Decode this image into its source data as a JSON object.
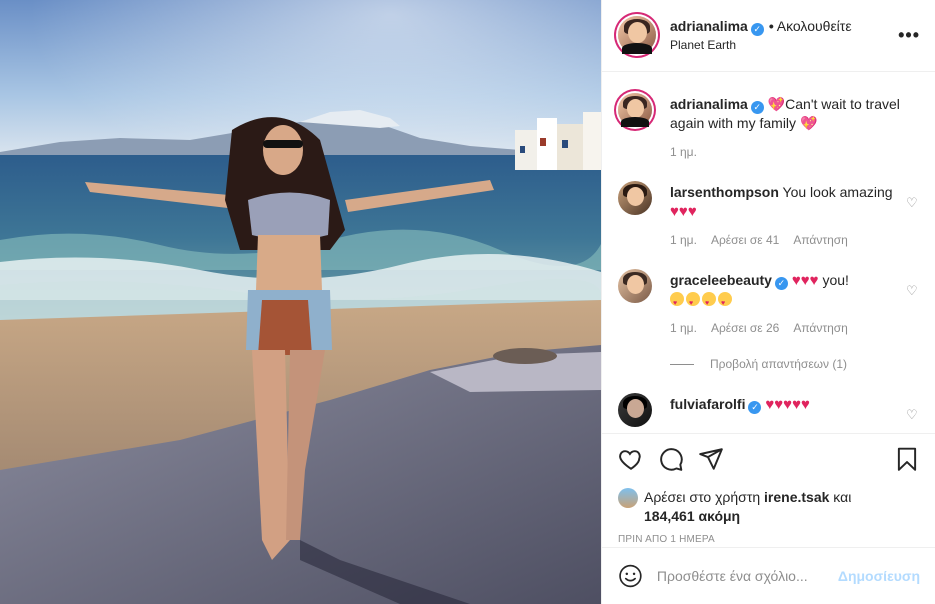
{
  "header": {
    "username": "adrianalima",
    "verified_mark": "✓",
    "separator": "•",
    "follow_status": "Ακολουθείτε",
    "location": "Planet Earth",
    "more_label": "•••"
  },
  "caption": {
    "username": "adrianalima",
    "text": "Can't wait to travel again with my family",
    "emoji_1": "💖",
    "emoji_2": "💖",
    "time": "1 ημ."
  },
  "comments": [
    {
      "username": "larsenthompson",
      "text": "You look amazing",
      "hearts": "♥♥♥",
      "time": "1 ημ.",
      "likes": "Αρέσει σε 41",
      "reply": "Απάντηση"
    },
    {
      "username": "graceleebeauty",
      "hearts": "♥♥♥",
      "text": "you!",
      "time": "1 ημ.",
      "likes": "Αρέσει σε 26",
      "reply": "Απάντηση"
    },
    {
      "username": "fulviafarolfi",
      "hearts": "♥♥♥♥♥"
    }
  ],
  "view_replies": "Προβολή απαντήσεων (1)",
  "likes": {
    "prefix": "Αρέσει στο χρήστη",
    "user": "irene.tsak",
    "connector": "και",
    "count": "184,461 ακόμη"
  },
  "timestamp": "ΠΡΙΝ ΑΠΟ 1 ΗΜΕΡΑ",
  "add_comment": {
    "placeholder": "Προσθέστε ένα σχόλιο...",
    "post_label": "Δημοσίευση"
  },
  "icons": {
    "like": "heart-outline-icon",
    "comment": "comment-bubble-icon",
    "share": "paper-plane-icon",
    "save": "bookmark-icon",
    "emoji": "smiley-icon",
    "verified": "verified-badge-icon",
    "comment_like": "small-heart-icon"
  },
  "colors": {
    "verified": "#3897f0",
    "heart": "#e0245e",
    "muted": "#8e8e8e",
    "post_button": "#b3dbff",
    "story_ring": "#d62976"
  }
}
